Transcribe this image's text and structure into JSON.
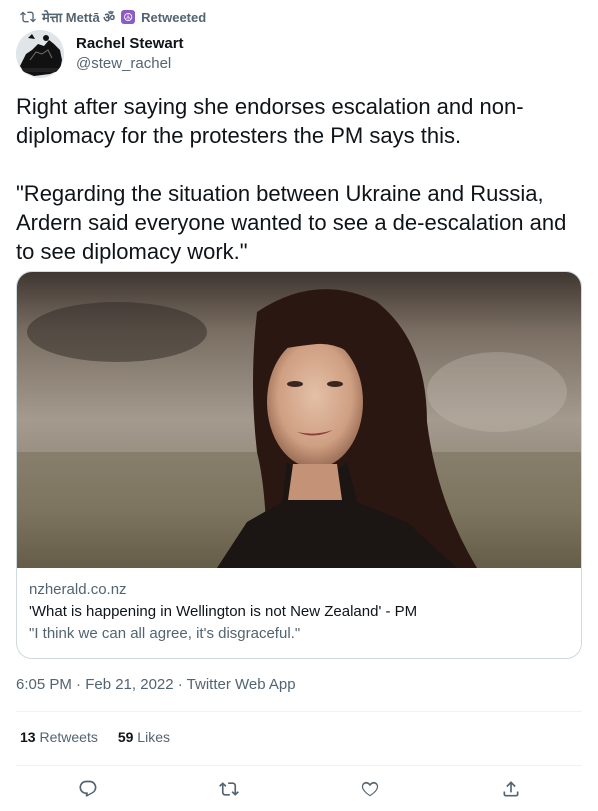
{
  "retweet_bar": {
    "retweeter_name": "मेत्ता Mettā ॐ",
    "peace_symbol": "☮",
    "label": "Retweeted"
  },
  "author": {
    "display_name": "Rachel Stewart",
    "handle": "@stew_rachel"
  },
  "tweet": {
    "text": "Right after saying she endorses escalation and non-diplomacy for the protesters the PM says this.\n\n\"Regarding the situation between Ukraine and Russia, Ardern said everyone wanted to see a de-escalation and to see diplomacy work.\""
  },
  "link_card": {
    "domain": "nzherald.co.nz",
    "title": "'What is happening in Wellington is not New Zealand' - PM",
    "description": "\"I think we can all agree, it's disgraceful.\""
  },
  "meta": {
    "timestamp": "6:05 PM · Feb 21, 2022 · Twitter Web App"
  },
  "stats": {
    "retweets_count": "13",
    "retweets_label": "Retweets",
    "likes_count": "59",
    "likes_label": "Likes"
  },
  "actions": [
    "reply-icon",
    "retweet-icon",
    "like-icon",
    "share-icon"
  ],
  "colors": {
    "text_primary": "#0f1419",
    "text_secondary": "#536471",
    "border": "#cfd9de",
    "divider": "#eff3f4"
  }
}
